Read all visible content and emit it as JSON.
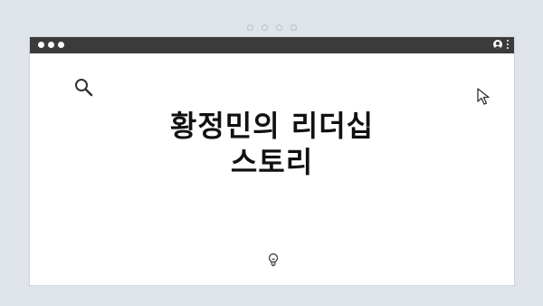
{
  "headline": {
    "line1": "황정민의 리더십",
    "line2": "스토리"
  },
  "icons": {
    "search": "search-icon",
    "cursor": "cursor-arrow-icon",
    "bulb": "lightbulb-icon",
    "user": "user-icon",
    "menu": "kebab-menu-icon"
  },
  "colors": {
    "background": "#dfe4ea",
    "titlebar": "#3b3b3b",
    "window": "#ffffff",
    "text": "#111111"
  }
}
